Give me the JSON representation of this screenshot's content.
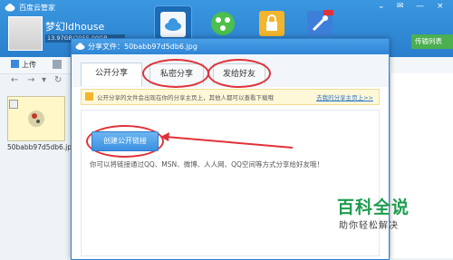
{
  "app": {
    "title": "百度云管家",
    "username": "梦幻ldhouse",
    "storage_text": "13.97GB/2055.00GB",
    "transfer_label": "传输列表",
    "window_controls": [
      "⌄",
      "✉",
      "—",
      "×"
    ]
  },
  "toolbar": {
    "upload_label": "上传"
  },
  "file": {
    "name": "50babb97d5db6.jpg"
  },
  "dialog": {
    "title": "分享文件：50babb97d5db6.jpg",
    "tabs": [
      {
        "label": "公开分享",
        "active": true
      },
      {
        "label": "私密分享",
        "active": false
      },
      {
        "label": "发给好友",
        "active": false
      }
    ],
    "notice": "公开分享的文件会出现在你的分享主页上，其他人都可以查看下载哦",
    "notice_link": "去我的分享主页上>>",
    "create_button": "创建公开链接",
    "hint": "你可以将链接通过QQ、MSN、微博、人人网、QQ空间等方式分享给好友哦！"
  },
  "watermark": {
    "title": "百科全说",
    "subtitle": "助你轻松解决"
  },
  "colors": {
    "header": "#2a7fcc",
    "highlight_ring": "#e0323a",
    "transfer_button": "#4caf50",
    "watermark": "#1e9c4f"
  }
}
